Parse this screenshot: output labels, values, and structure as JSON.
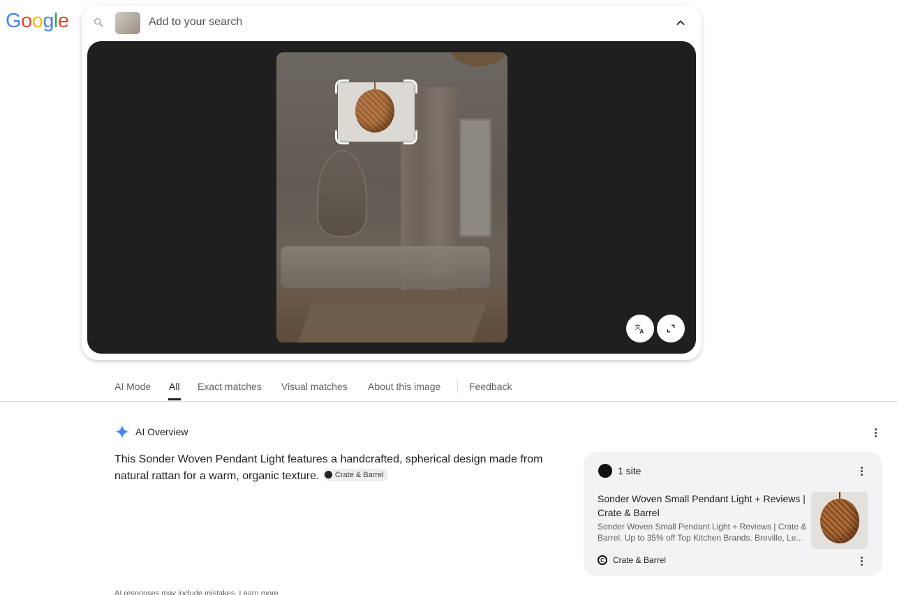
{
  "logo": {
    "letters": [
      "G",
      "o",
      "o",
      "g",
      "l",
      "e"
    ],
    "colors": [
      "#4285F4",
      "#EA4335",
      "#FBBC05",
      "#4285F4",
      "#34A853",
      "#EA4335"
    ]
  },
  "search": {
    "placeholder": "Add to your search",
    "icons": [
      "search-icon",
      "chevron-up-icon"
    ]
  },
  "lens": {
    "buttons": [
      "translate-icon",
      "expand-icon"
    ]
  },
  "tabs": [
    "AI Mode",
    "All",
    "Exact matches",
    "Visual matches",
    "About this image",
    "Feedback"
  ],
  "active_tab": "All",
  "ai_overview": {
    "title": "AI Overview",
    "body": "This Sonder Woven Pendant Light features a handcrafted, spherical design made from natural rattan for a warm, organic texture.",
    "chip": "Crate & Barrel",
    "accent": "#4285F4"
  },
  "sites": {
    "count_label": "1 site",
    "title": "Sonder Woven Small Pendant Light + Reviews | Crate & Barrel",
    "snippet": "Sonder Woven Small Pendant Light + Reviews | Crate & Barrel. Up to 35% off Top Kitchen Brands. Breville, Le...",
    "source": "Crate & Barrel",
    "favicon_text": "Crate"
  },
  "footer": {
    "text": "AI responses may include mistakes. Learn more"
  }
}
